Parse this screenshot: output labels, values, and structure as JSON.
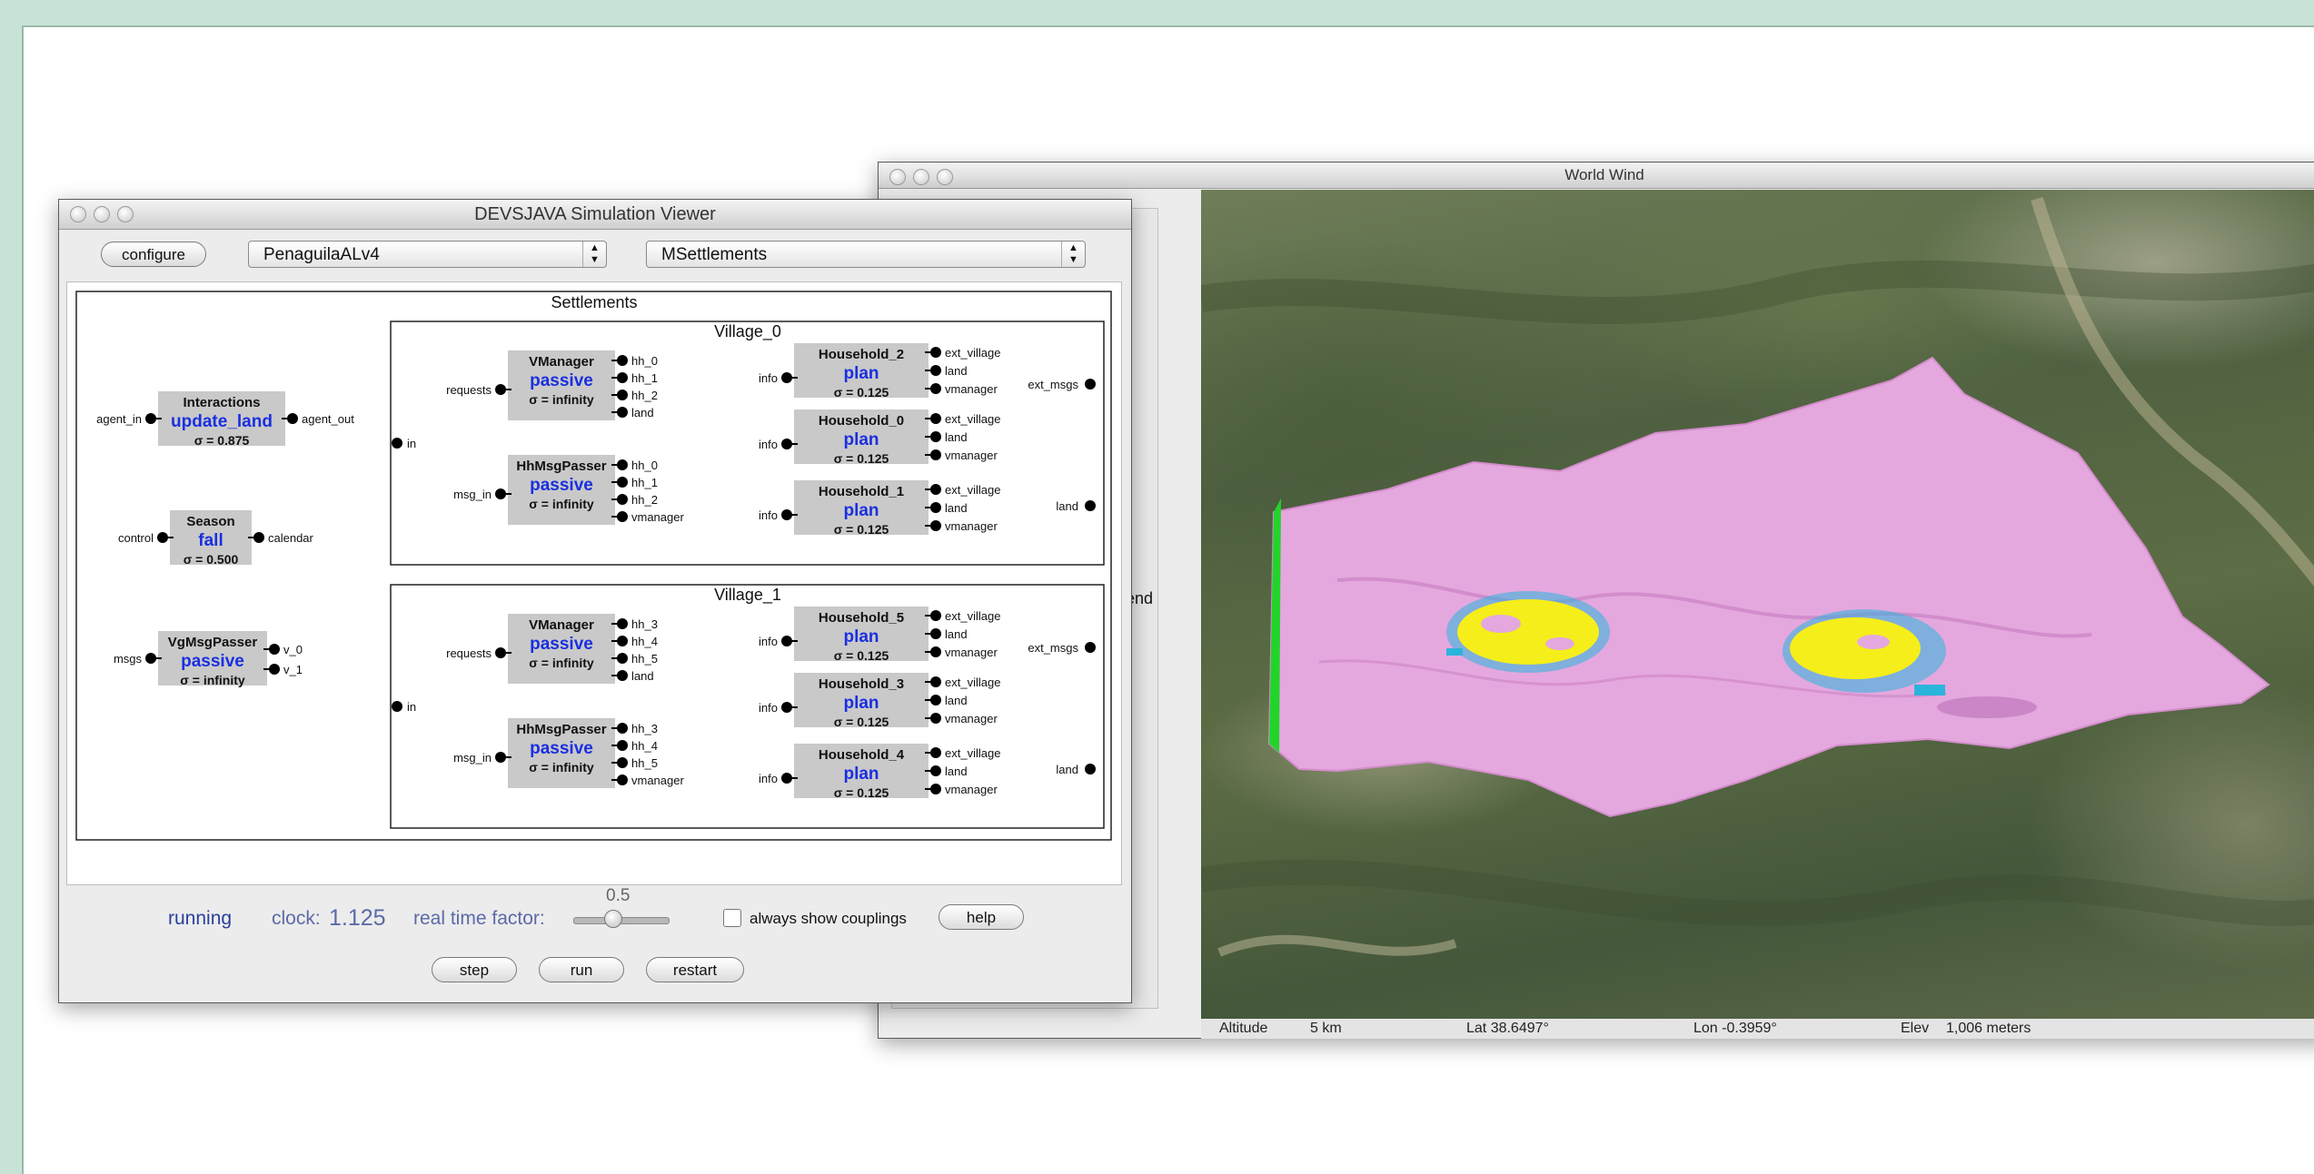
{
  "devs_window": {
    "title": "DEVSJAVA Simulation Viewer",
    "configure_label": "configure",
    "model_select": "PenaguilaALv4",
    "component_select": "MSettlements",
    "status": "running",
    "clock_label": "clock:",
    "clock_value": "1.125",
    "rtf_label": "real time factor:",
    "rtf_value": "0.5",
    "always_show_couplings": "always show couplings",
    "help_label": "help",
    "step_label": "step",
    "run_label": "run",
    "restart_label": "restart"
  },
  "diagram": {
    "settlements": "Settlements",
    "interactions": {
      "name": "Interactions",
      "phase": "update_land",
      "sigma": "σ = 0.875",
      "in": "agent_in",
      "out": "agent_out"
    },
    "season": {
      "name": "Season",
      "phase": "fall",
      "sigma": "σ = 0.500",
      "in": "control",
      "out": "calendar"
    },
    "vgmsg": {
      "name": "VgMsgPasser",
      "phase": "passive",
      "sigma": "σ = infinity",
      "in": "msgs",
      "out0": "v_0",
      "out1": "v_1"
    },
    "v0": {
      "title": "Village_0",
      "in": "in",
      "requests": "requests",
      "msg_in": "msg_in",
      "info": "info",
      "ext_msgs": "ext_msgs",
      "land": "land",
      "vmanager": {
        "name": "VManager",
        "phase": "passive",
        "sigma": "σ = infinity",
        "p0": "hh_0",
        "p1": "hh_1",
        "p2": "hh_2",
        "p3": "land"
      },
      "hhmsg": {
        "name": "HhMsgPasser",
        "phase": "passive",
        "sigma": "σ = infinity",
        "p0": "hh_0",
        "p1": "hh_1",
        "p2": "hh_2",
        "p3": "vmanager"
      },
      "hA": {
        "name": "Household_2",
        "phase": "plan",
        "sigma": "σ = 0.125",
        "p0": "ext_village",
        "p1": "land",
        "p2": "vmanager"
      },
      "hB": {
        "name": "Household_0",
        "phase": "plan",
        "sigma": "σ = 0.125",
        "p0": "ext_village",
        "p1": "land",
        "p2": "vmanager"
      },
      "hC": {
        "name": "Household_1",
        "phase": "plan",
        "sigma": "σ = 0.125",
        "p0": "ext_village",
        "p1": "land",
        "p2": "vmanager"
      }
    },
    "v1": {
      "title": "Village_1",
      "in": "in",
      "requests": "requests",
      "msg_in": "msg_in",
      "info": "info",
      "ext_msgs": "ext_msgs",
      "land": "land",
      "vmanager": {
        "name": "VManager",
        "phase": "passive",
        "sigma": "σ = infinity",
        "p0": "hh_3",
        "p1": "hh_4",
        "p2": "hh_5",
        "p3": "land"
      },
      "hhmsg": {
        "name": "HhMsgPasser",
        "phase": "passive",
        "sigma": "σ = infinity",
        "p0": "hh_3",
        "p1": "hh_4",
        "p2": "hh_5",
        "p3": "vmanager"
      },
      "hA": {
        "name": "Household_5",
        "phase": "plan",
        "sigma": "σ = 0.125",
        "p0": "ext_village",
        "p1": "land",
        "p2": "vmanager"
      },
      "hB": {
        "name": "Household_3",
        "phase": "plan",
        "sigma": "σ = 0.125",
        "p0": "ext_village",
        "p1": "land",
        "p2": "vmanager"
      },
      "hC": {
        "name": "Household_4",
        "phase": "plan",
        "sigma": "σ = 0.125",
        "p0": "ext_village",
        "p1": "land",
        "p2": "vmanager"
      }
    }
  },
  "worldwind": {
    "title": "World Wind",
    "partial_text": "end",
    "altitude_label": "Altitude",
    "altitude_value": "5 km",
    "lat": "Lat 38.6497°",
    "lon": "Lon -0.3959°",
    "elev_label": "Elev",
    "elev_value": "1,006 meters"
  },
  "colors": {
    "phase_blue": "#1a2fe0",
    "overlay_pink": "#e4a8de",
    "settlement_yellow": "#f5ee1a",
    "settlement_cyan": "#2ab4dc",
    "edge_green": "#22d42a"
  }
}
